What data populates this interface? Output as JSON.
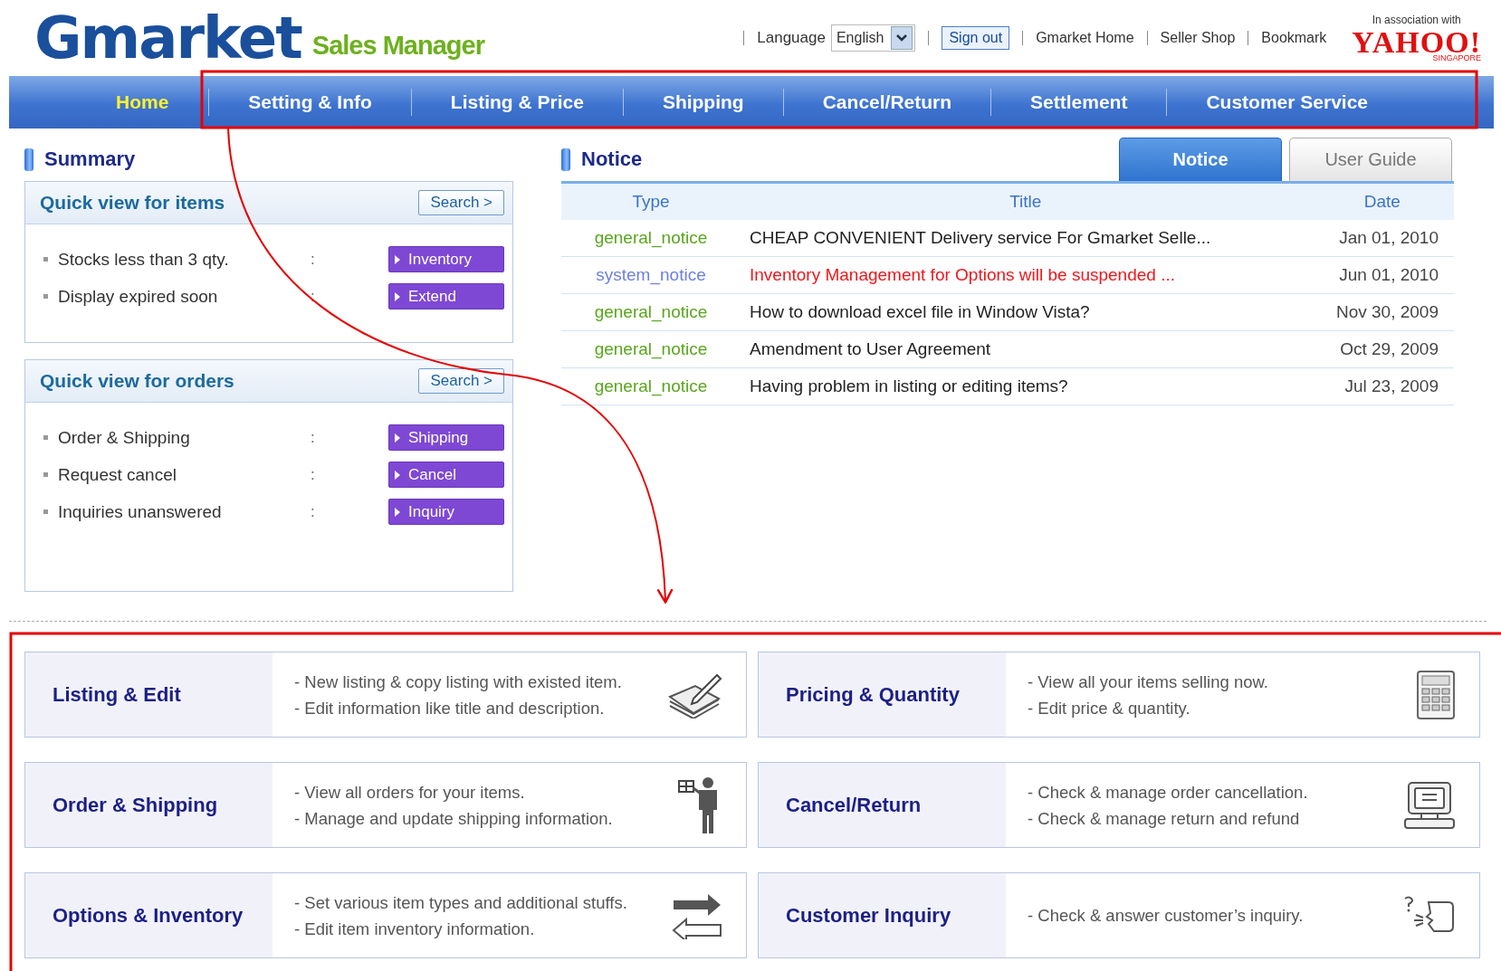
{
  "header": {
    "logo": "Gmarket",
    "product": "Sales Manager",
    "language_label": "Language",
    "language": {
      "value": "English"
    },
    "sign_out": "Sign out",
    "links": [
      "Gmarket Home",
      "Seller Shop",
      "Bookmark"
    ],
    "partner_note": "In association with",
    "partner": "YAHOO!",
    "partner_region": "SINGAPORE"
  },
  "nav": [
    {
      "label": "Home",
      "selected": true
    },
    {
      "label": "Setting & Info",
      "selected": false
    },
    {
      "label": "Listing & Price",
      "selected": false
    },
    {
      "label": "Shipping",
      "selected": false
    },
    {
      "label": "Cancel/Return",
      "selected": false
    },
    {
      "label": "Settlement",
      "selected": false
    },
    {
      "label": "Customer Service",
      "selected": false
    }
  ],
  "summary": {
    "title": "Summary",
    "panels": [
      {
        "title": "Quick view for items",
        "search": "Search >",
        "rows": [
          {
            "label": "Stocks less than 3 qty.",
            "separator": ":",
            "button": "Inventory"
          },
          {
            "label": "Display expired soon",
            "separator": ":",
            "button": "Extend"
          }
        ]
      },
      {
        "title": "Quick view for orders",
        "search": "Search >",
        "rows": [
          {
            "label": "Order & Shipping",
            "separator": ":",
            "button": "Shipping"
          },
          {
            "label": "Request cancel",
            "separator": ":",
            "button": "Cancel"
          },
          {
            "label": "Inquiries unanswered",
            "separator": ":",
            "button": "Inquiry"
          }
        ]
      }
    ]
  },
  "notice": {
    "title": "Notice",
    "tabs": [
      {
        "label": "Notice",
        "selected": true
      },
      {
        "label": "User Guide",
        "selected": false
      }
    ],
    "columns": [
      "Type",
      "Title",
      "Date"
    ],
    "rows": [
      {
        "kind": "general",
        "type": "general_notice",
        "title": "CHEAP CONVENIENT Delivery service For Gmarket Selle...",
        "date": "Jan 01, 2010"
      },
      {
        "kind": "system",
        "type": "system_notice",
        "title": "Inventory Management for Options will be suspended ...",
        "date": "Jun 01, 2010"
      },
      {
        "kind": "general",
        "type": "general_notice",
        "title": "How to download excel file in Window Vista?",
        "date": "Nov 30, 2009"
      },
      {
        "kind": "general",
        "type": "general_notice",
        "title": "Amendment to User Agreement",
        "date": "Oct 29, 2009"
      },
      {
        "kind": "general",
        "type": "general_notice",
        "title": "Having problem in listing or editing items?",
        "date": "Jul 23, 2009"
      }
    ]
  },
  "cards": [
    {
      "title": "Listing & Edit",
      "lines": [
        "- New listing & copy listing with existed item.",
        "- Edit information like title and description."
      ]
    },
    {
      "title": "Pricing & Quantity",
      "lines": [
        "- View all your items selling now.",
        "- Edit price & quantity."
      ]
    },
    {
      "title": "Order & Shipping",
      "lines": [
        "- View all orders for your items.",
        "- Manage and update shipping information."
      ]
    },
    {
      "title": "Cancel/Return",
      "lines": [
        "- Check & manage order cancellation.",
        "- Check & manage return and refund"
      ]
    },
    {
      "title": "Options & Inventory",
      "lines": [
        "- Set various item types and additional stuffs.",
        "- Edit item inventory information."
      ]
    },
    {
      "title": "Customer Inquiry",
      "lines": [
        "- Check & answer customer’s inquiry."
      ]
    }
  ]
}
